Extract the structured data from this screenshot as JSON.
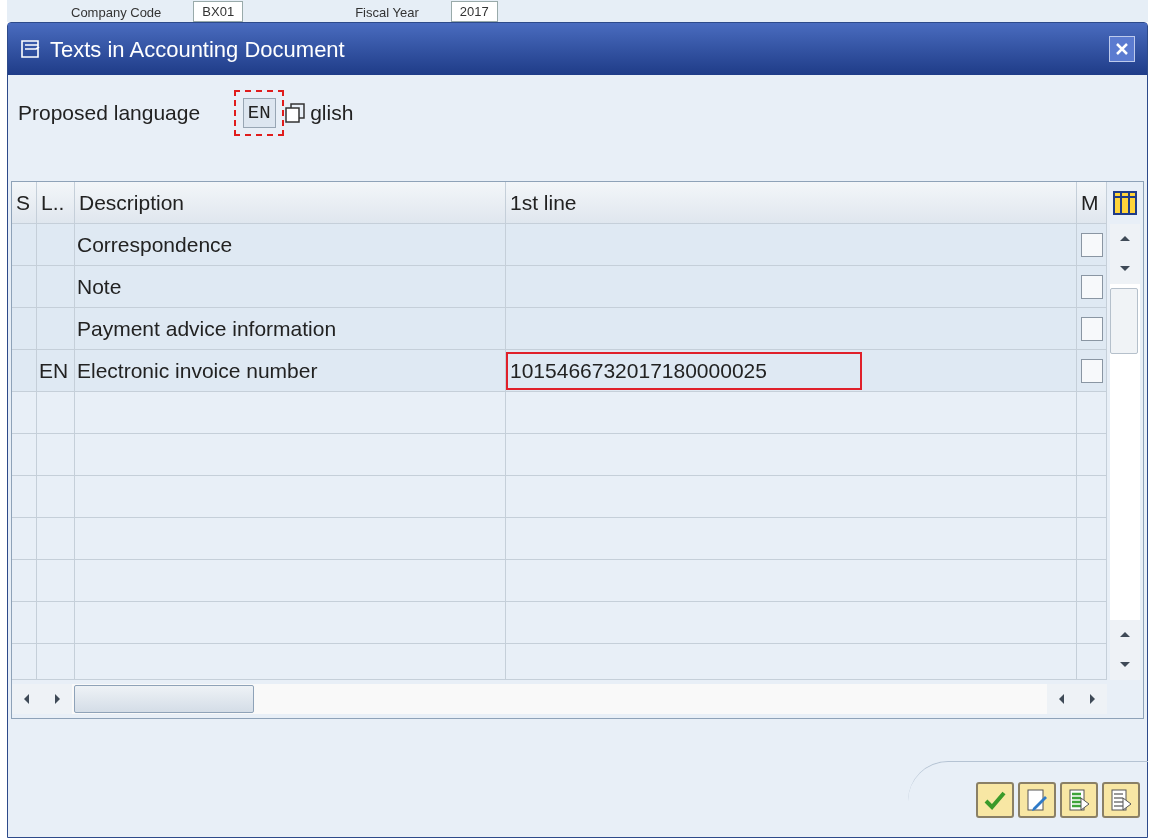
{
  "background_fields": [
    {
      "label": "Company Code",
      "value": "BX01"
    },
    {
      "label": "Fiscal Year",
      "value": "2017"
    }
  ],
  "dialog": {
    "title": "Texts in Accounting Document"
  },
  "language": {
    "label": "Proposed language",
    "code": "EN",
    "name": "glish",
    "focused": true
  },
  "table": {
    "columns": [
      "S",
      "L..",
      "Description",
      "1st line",
      "M"
    ],
    "rows": [
      {
        "s": "",
        "lang": "",
        "description": "Correspondence",
        "first_line": "",
        "highlighted": false,
        "m_checked": false
      },
      {
        "s": "",
        "lang": "",
        "description": "Note",
        "first_line": "",
        "highlighted": false,
        "m_checked": false
      },
      {
        "s": "",
        "lang": "",
        "description": "Payment advice information",
        "first_line": "",
        "highlighted": false,
        "m_checked": false
      },
      {
        "s": "",
        "lang": "EN",
        "description": "Electronic invoice number",
        "first_line": "1015466732017180000025",
        "highlighted": true,
        "m_checked": false
      }
    ]
  }
}
